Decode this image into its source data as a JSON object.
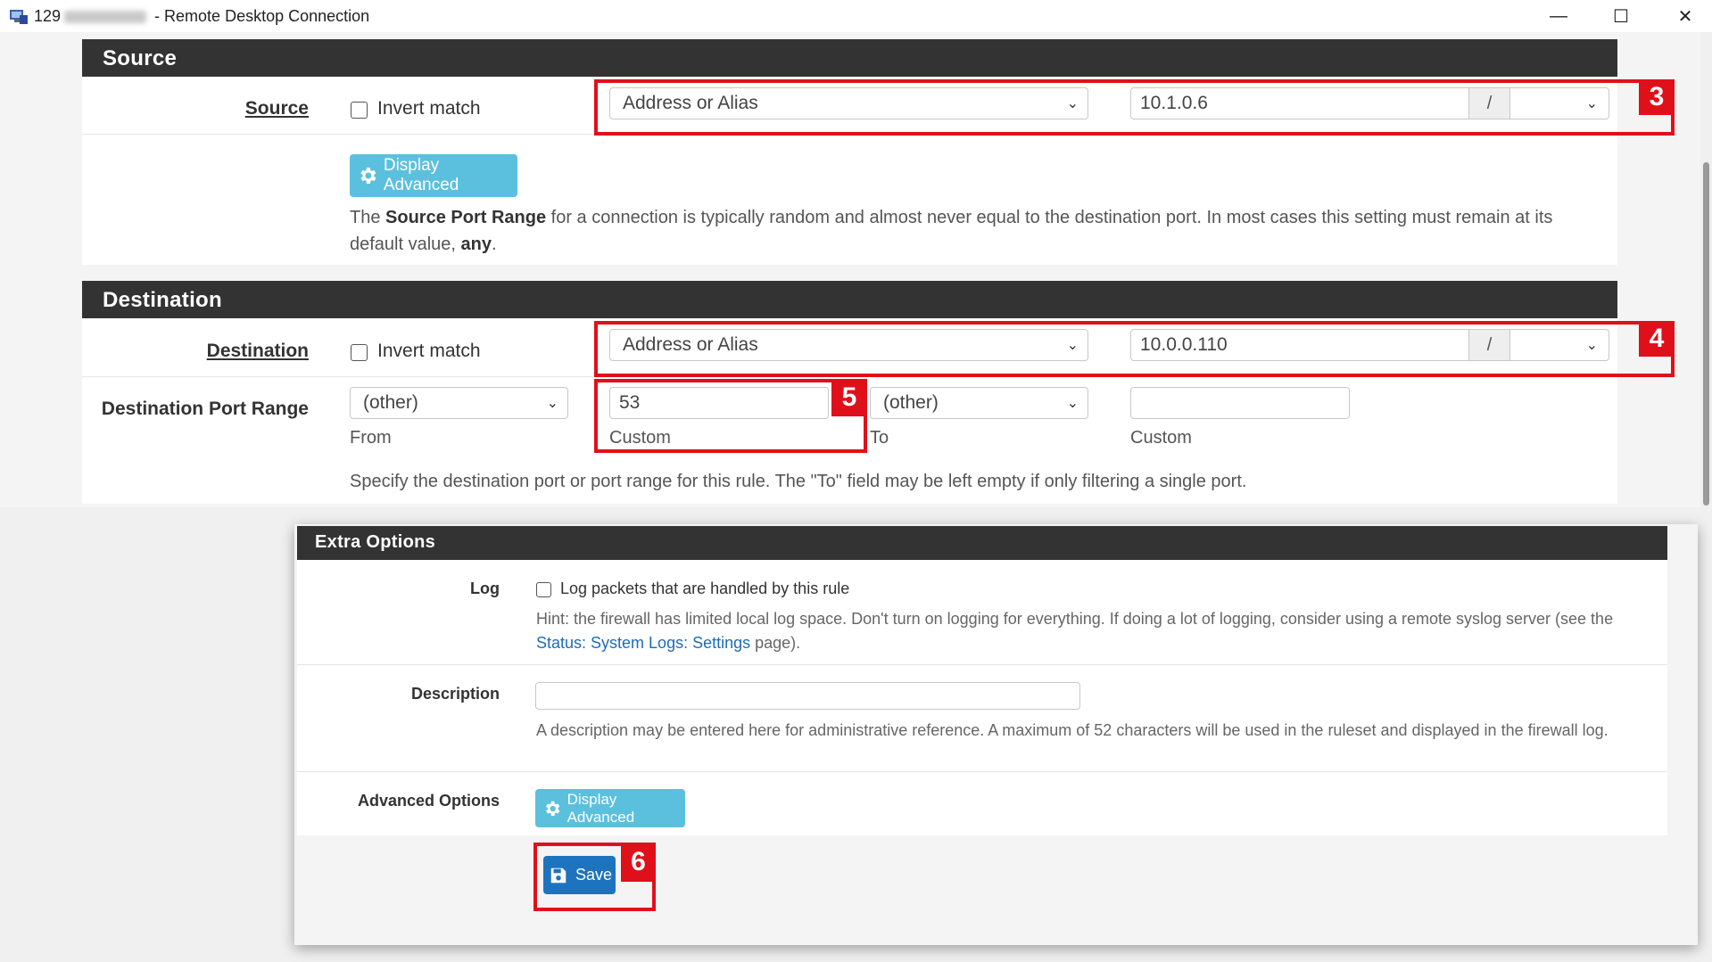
{
  "window": {
    "title_prefix": "129",
    "title_suffix": " - Remote Desktop Connection",
    "minimize": "—",
    "maximize": "☐",
    "close": "✕"
  },
  "source": {
    "header": "Source",
    "label": "Source",
    "invert_label": "Invert match",
    "type_value": "Address or Alias",
    "address_value": "10.1.0.6",
    "slash": "/",
    "mask_value": "",
    "advanced_button": "Display Advanced",
    "help_pre": "The ",
    "help_bold1": "Source Port Range",
    "help_mid": " for a connection is typically random and almost never equal to the destination port. In most cases this setting must remain at its default value, ",
    "help_bold2": "any",
    "help_post": "."
  },
  "destination": {
    "header": "Destination",
    "label": "Destination",
    "invert_label": "Invert match",
    "type_value": "Address or Alias",
    "address_value": "10.0.0.110",
    "slash": "/",
    "mask_value": "",
    "port_range_label": "Destination Port Range",
    "from_select": "(other)",
    "from_label": "From",
    "from_custom_value": "53",
    "from_custom_label": "Custom",
    "to_select": "(other)",
    "to_label": "To",
    "to_custom_value": "",
    "to_custom_label": "Custom",
    "port_help": "Specify the destination port or port range for this rule. The \"To\" field may be left empty if only filtering a single port."
  },
  "extra_options": {
    "header": "Extra Options",
    "log_label": "Log",
    "log_checkbox_label": "Log packets that are handled by this rule",
    "log_hint_pre": "Hint: the firewall has limited local log space. Don't turn on logging for everything. If doing a lot of logging, consider using a remote syslog server (see the ",
    "log_hint_link": "Status: System Logs: Settings",
    "log_hint_post": " page).",
    "description_label": "Description",
    "description_value": "",
    "description_help": "A description may be entered here for administrative reference. A maximum of 52 characters will be used in the ruleset and displayed in the firewall log.",
    "advanced_label": "Advanced Options",
    "advanced_button": "Display Advanced",
    "save_button": "Save"
  },
  "annotations": {
    "badge3": "3",
    "badge4": "4",
    "badge5": "5",
    "badge6": "6",
    "color": "#e0101a"
  },
  "colors": {
    "panel_header": "#333333",
    "info_button": "#5bc0de",
    "primary_button": "#1e73be",
    "link": "#1e6bb8"
  }
}
